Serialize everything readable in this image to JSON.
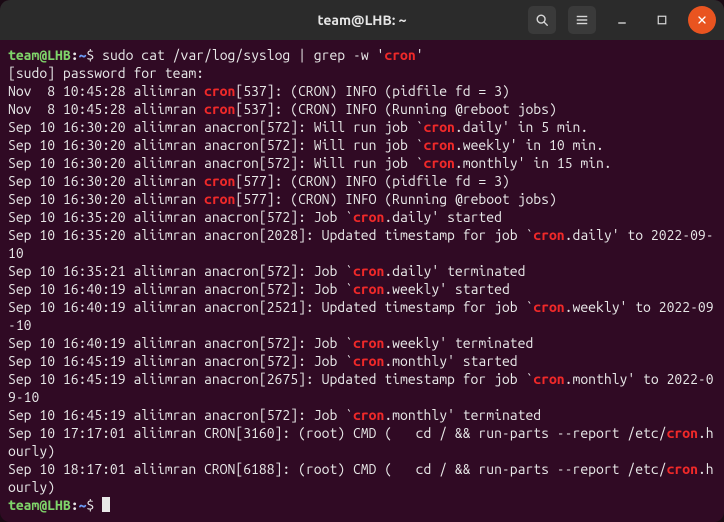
{
  "window": {
    "title": "team@LHB: ~",
    "buttons": {
      "search": "search-icon",
      "menu": "hamburger-icon",
      "minimize": "minimize-icon",
      "maximize": "maximize-icon",
      "close": "close-icon"
    }
  },
  "prompt": {
    "user_host": "team@LHB",
    "colon": ":",
    "cwd": "~",
    "dollar": "$ "
  },
  "command": {
    "prefix": "sudo cat /var/log/syslog | grep -w '",
    "hl": "cron",
    "suffix": "'"
  },
  "sudo_line": "[sudo] password for team:",
  "lines": [
    {
      "segs": [
        {
          "t": "Nov  8 10:45:28 aliimran "
        },
        {
          "t": "cron",
          "hl": 1
        },
        {
          "t": "[537]: (CRON) INFO (pidfile fd = 3)"
        }
      ]
    },
    {
      "segs": [
        {
          "t": "Nov  8 10:45:28 aliimran "
        },
        {
          "t": "cron",
          "hl": 1
        },
        {
          "t": "[537]: (CRON) INFO (Running @reboot jobs)"
        }
      ]
    },
    {
      "segs": [
        {
          "t": "Sep 10 16:30:20 aliimran anacron[572]: Will run job `"
        },
        {
          "t": "cron",
          "hl": 1
        },
        {
          "t": ".daily' in 5 min."
        }
      ]
    },
    {
      "segs": [
        {
          "t": "Sep 10 16:30:20 aliimran anacron[572]: Will run job `"
        },
        {
          "t": "cron",
          "hl": 1
        },
        {
          "t": ".weekly' in 10 min."
        }
      ]
    },
    {
      "segs": [
        {
          "t": "Sep 10 16:30:20 aliimran anacron[572]: Will run job `"
        },
        {
          "t": "cron",
          "hl": 1
        },
        {
          "t": ".monthly' in 15 min."
        }
      ]
    },
    {
      "segs": [
        {
          "t": "Sep 10 16:30:20 aliimran "
        },
        {
          "t": "cron",
          "hl": 1
        },
        {
          "t": "[577]: (CRON) INFO (pidfile fd = 3)"
        }
      ]
    },
    {
      "segs": [
        {
          "t": "Sep 10 16:30:20 aliimran "
        },
        {
          "t": "cron",
          "hl": 1
        },
        {
          "t": "[577]: (CRON) INFO (Running @reboot jobs)"
        }
      ]
    },
    {
      "segs": [
        {
          "t": "Sep 10 16:35:20 aliimran anacron[572]: Job `"
        },
        {
          "t": "cron",
          "hl": 1
        },
        {
          "t": ".daily' started"
        }
      ]
    },
    {
      "segs": [
        {
          "t": "Sep 10 16:35:20 aliimran anacron[2028]: Updated timestamp for job `"
        },
        {
          "t": "cron",
          "hl": 1
        },
        {
          "t": ".daily' to 2022-09-10"
        }
      ]
    },
    {
      "segs": [
        {
          "t": "Sep 10 16:35:21 aliimran anacron[572]: Job `"
        },
        {
          "t": "cron",
          "hl": 1
        },
        {
          "t": ".daily' terminated"
        }
      ]
    },
    {
      "segs": [
        {
          "t": "Sep 10 16:40:19 aliimran anacron[572]: Job `"
        },
        {
          "t": "cron",
          "hl": 1
        },
        {
          "t": ".weekly' started"
        }
      ]
    },
    {
      "segs": [
        {
          "t": "Sep 10 16:40:19 aliimran anacron[2521]: Updated timestamp for job `"
        },
        {
          "t": "cron",
          "hl": 1
        },
        {
          "t": ".weekly' to 2022-09-10"
        }
      ]
    },
    {
      "segs": [
        {
          "t": "Sep 10 16:40:19 aliimran anacron[572]: Job `"
        },
        {
          "t": "cron",
          "hl": 1
        },
        {
          "t": ".weekly' terminated"
        }
      ]
    },
    {
      "segs": [
        {
          "t": "Sep 10 16:45:19 aliimran anacron[572]: Job `"
        },
        {
          "t": "cron",
          "hl": 1
        },
        {
          "t": ".monthly' started"
        }
      ]
    },
    {
      "segs": [
        {
          "t": "Sep 10 16:45:19 aliimran anacron[2675]: Updated timestamp for job `"
        },
        {
          "t": "cron",
          "hl": 1
        },
        {
          "t": ".monthly' to 2022-09-10"
        }
      ]
    },
    {
      "segs": [
        {
          "t": "Sep 10 16:45:19 aliimran anacron[572]: Job `"
        },
        {
          "t": "cron",
          "hl": 1
        },
        {
          "t": ".monthly' terminated"
        }
      ]
    },
    {
      "segs": [
        {
          "t": "Sep 10 17:17:01 aliimran CRON[3160]: (root) CMD (   cd / && run-parts --report /etc/"
        },
        {
          "t": "cron",
          "hl": 1
        },
        {
          "t": ".hourly)"
        }
      ]
    },
    {
      "segs": [
        {
          "t": "Sep 10 18:17:01 aliimran CRON[6188]: (root) CMD (   cd / && run-parts --report /etc/"
        },
        {
          "t": "cron",
          "hl": 1
        },
        {
          "t": ".hourly)"
        }
      ]
    }
  ]
}
